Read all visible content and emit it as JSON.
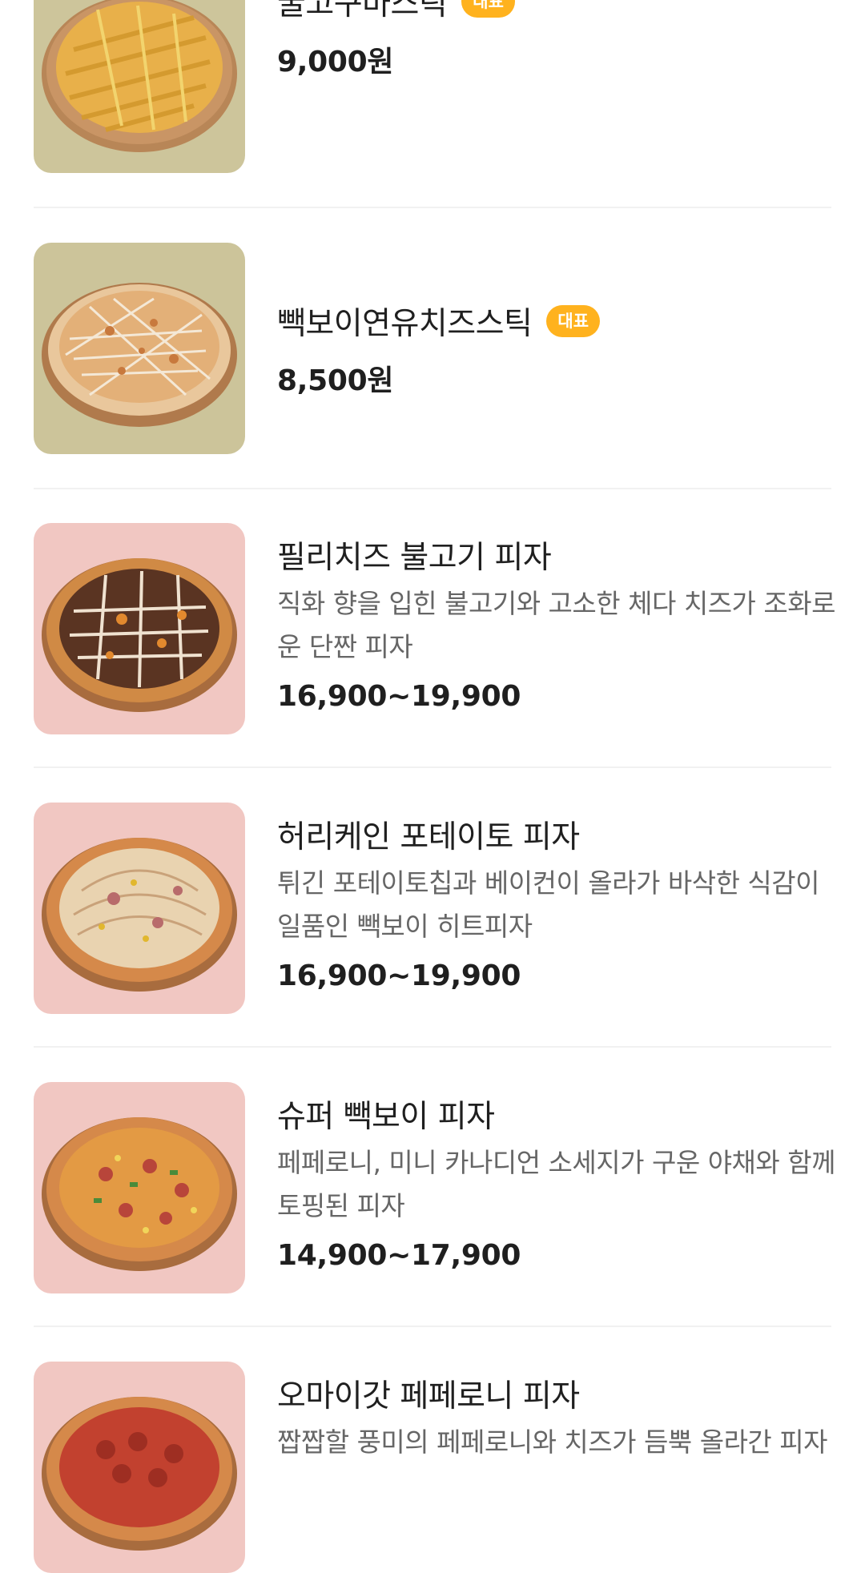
{
  "menu": {
    "items": [
      {
        "name": "꿀고구마스틱",
        "badge": "대표",
        "price": "9,000원",
        "image": {
          "kind": "sweet-potato-stick",
          "background": "#cdc59b",
          "icon": "pizza-image"
        }
      },
      {
        "name": "빽보이연유치즈스틱",
        "badge": "대표",
        "price": "8,500원",
        "image": {
          "kind": "condensed-milk-cheese-stick",
          "background": "#ccc49a",
          "icon": "pizza-image"
        }
      },
      {
        "name": "필리치즈 불고기 피자",
        "description": "직화 향을 입힌 불고기와 고소한 체다 치즈가 조화로운 단짠 피자",
        "price": "16,900~19,900",
        "image": {
          "kind": "bulgogi-pizza",
          "background": "#f1c7c2",
          "icon": "pizza-image"
        }
      },
      {
        "name": "허리케인 포테이토 피자",
        "description": "튀긴 포테이토칩과 베이컨이 올라가 바삭한 식감이 일품인 빽보이 히트피자",
        "price": "16,900~19,900",
        "image": {
          "kind": "potato-pizza",
          "background": "#f1c7c2",
          "icon": "pizza-image"
        }
      },
      {
        "name": "슈퍼 빽보이 피자",
        "description": "페페로니, 미니 카나디언 소세지가 구운 야채와 함께 토핑된 피자",
        "price": "14,900~17,900",
        "image": {
          "kind": "super-pizza",
          "background": "#f1c7c2",
          "icon": "pizza-image"
        }
      },
      {
        "name": "오마이갓 페페로니 피자",
        "description": "짭짭할 풍미의 페페로니와 치즈가 듬뿍 올라간 피자",
        "price": "",
        "image": {
          "kind": "pepperoni-pizza",
          "background": "#f1c7c2",
          "icon": "pizza-image"
        }
      }
    ]
  },
  "colors": {
    "badge": "#ffb21e",
    "title_text": "#1f1f1f",
    "description_text": "#666666",
    "divider": "#f1f1f1"
  }
}
